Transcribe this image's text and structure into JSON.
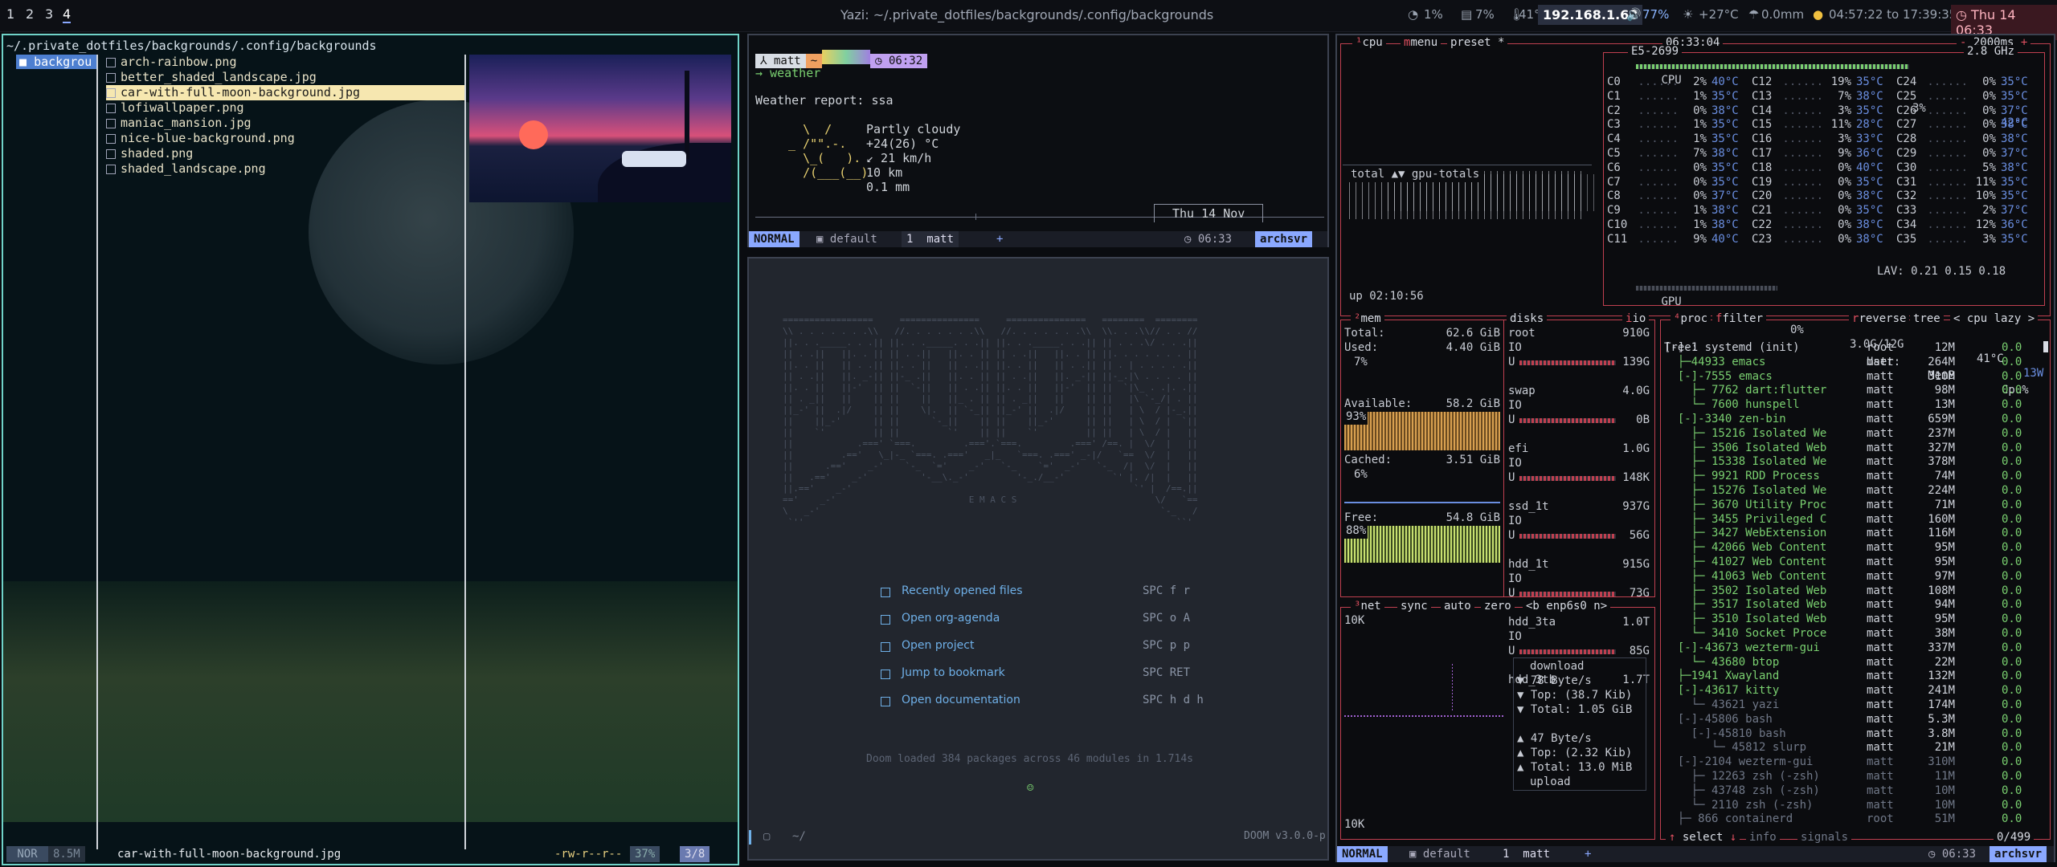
{
  "topbar": {
    "workspaces": [
      "1",
      "2",
      "3",
      "4"
    ],
    "active_workspace": "4",
    "window_title": "Yazi: ~/.private_dotfiles/backgrounds/.config/backgrounds",
    "cpu": "1%",
    "mem": "7%",
    "temp": "41°C",
    "ip": "192.168.1.68",
    "volume": "77%",
    "weather": "+27°C",
    "rain": "0.0mm",
    "sun": "04:57:22 to 17:39:35",
    "clock": "Thu 14 06:33"
  },
  "yazi": {
    "path": "~/.private_dotfiles/backgrounds/.config/backgrounds",
    "parent_item": "backgrou",
    "files": [
      "arch-rainbow.png",
      "better_shaded_landscape.jpg",
      "car-with-full-moon-background.jpg",
      "lofiwallpaper.png",
      "maniac_mansion.jpg",
      "nice-blue-background.png",
      "shaded.png",
      "shaded_landscape.png"
    ],
    "selected_index": 2,
    "status": {
      "mode": "NOR",
      "size": "8.5M",
      "filename": "car-with-full-moon-background.jpg",
      "perms": "-rw-r--r--",
      "percent": "37%",
      "position": "3/8"
    }
  },
  "weather_pane": {
    "user": "matt",
    "arrow": "~",
    "time": "06:32",
    "command": "weather",
    "report_line": "Weather report: ssa",
    "ascii": "   \\  /\n _ /\"\".-.\n   \\_(   ).\n   /(___(__)",
    "info": "Partly cloudy\n+24(26) °C\n↙ 21 km/h\n10 km\n0.1 mm",
    "date_box": "Thu 14 Nov",
    "tmux": {
      "mode": "NORMAL",
      "session": "default",
      "window_index": "1",
      "window_name": "matt",
      "plus": "+",
      "time": "06:33",
      "host": "archsvr"
    }
  },
  "emacs": {
    "banner": "E M A C S",
    "menu": [
      {
        "label": "Recently opened files",
        "key": "SPC f r"
      },
      {
        "label": "Open org-agenda",
        "key": "SPC o A"
      },
      {
        "label": "Open project",
        "key": "SPC p p"
      },
      {
        "label": "Jump to bookmark",
        "key": "SPC RET"
      },
      {
        "label": "Open documentation",
        "key": "SPC h d h"
      }
    ],
    "loaded": "Doom loaded 384 packages across 46 modules in 1.714s",
    "modeline_path": "~/",
    "modeline_right": "DOOM v3.0.0-p"
  },
  "btop": {
    "cpu_box": {
      "title_items": [
        "cpu",
        "menu",
        "preset *"
      ],
      "clock": "06:33:04",
      "interval": "2000ms",
      "model": "E5-2699",
      "freq": "2.8 GHz",
      "total_label": "CPU",
      "total_pct": "3%",
      "total_temp": "42°C",
      "graph_label": "total ▲▼ gpu-totals",
      "uptime": "up 02:10:56",
      "lav": "LAV: 0.21 0.15 0.18",
      "gpu_label": "GPU",
      "gpu_pct": "0%",
      "gpu_mem": "3.0G/12G",
      "gpu_temp": "41°C",
      "gpu_w": "13W",
      "cores": [
        [
          "C0",
          "2%",
          "40°C",
          "C12",
          "19%",
          "35°C",
          "C24",
          "0%",
          "35°C"
        ],
        [
          "C1",
          "1%",
          "35°C",
          "C13",
          "7%",
          "38°C",
          "C25",
          "0%",
          "35°C"
        ],
        [
          "C2",
          "0%",
          "38°C",
          "C14",
          "3%",
          "35°C",
          "C26",
          "0%",
          "37°C"
        ],
        [
          "C3",
          "1%",
          "35°C",
          "C15",
          "11%",
          "28°C",
          "C27",
          "0%",
          "38°C"
        ],
        [
          "C4",
          "1%",
          "35°C",
          "C16",
          "3%",
          "33°C",
          "C28",
          "0%",
          "38°C"
        ],
        [
          "C5",
          "7%",
          "38°C",
          "C17",
          "9%",
          "36°C",
          "C29",
          "0%",
          "37°C"
        ],
        [
          "C6",
          "0%",
          "35°C",
          "C18",
          "0%",
          "40°C",
          "C30",
          "5%",
          "38°C"
        ],
        [
          "C7",
          "0%",
          "35°C",
          "C19",
          "0%",
          "35°C",
          "C31",
          "11%",
          "35°C"
        ],
        [
          "C8",
          "0%",
          "37°C",
          "C20",
          "0%",
          "38°C",
          "C32",
          "10%",
          "35°C"
        ],
        [
          "C9",
          "1%",
          "38°C",
          "C21",
          "0%",
          "35°C",
          "C33",
          "2%",
          "37°C"
        ],
        [
          "C10",
          "1%",
          "38°C",
          "C22",
          "0%",
          "38°C",
          "C34",
          "12%",
          "36°C"
        ],
        [
          "C11",
          "9%",
          "40°C",
          "C23",
          "0%",
          "38°C",
          "C35",
          "3%",
          "35°C"
        ]
      ]
    },
    "mem_box": {
      "title": "mem",
      "total_label": "Total:",
      "total": "62.6 GiB",
      "used_label": "Used:",
      "used": "4.40 GiB",
      "used_pct": "7%",
      "avail_label": "Available:",
      "avail": "58.2 GiB",
      "avail_pct": "93%",
      "cached_label": "Cached:",
      "cached": "3.51 GiB",
      "cached_pct": "6%",
      "free_label": "Free:",
      "free": "54.8 GiB",
      "free_pct": "88%"
    },
    "disks_box": {
      "title": "disks",
      "io_label": "io",
      "disks": [
        {
          "name": "root",
          "size": "910G",
          "used": "139G"
        },
        {
          "name": "swap",
          "size": "4.0G",
          "used": "0B"
        },
        {
          "name": "efi",
          "size": "1.0G",
          "used": "148K"
        },
        {
          "name": "ssd_1t",
          "size": "937G",
          "used": "56G"
        },
        {
          "name": "hdd_1t",
          "size": "915G",
          "used": "73G"
        },
        {
          "name": "hdd_3ta",
          "size": "1.0T",
          "used": "85G"
        },
        {
          "name": "hdd_3tb",
          "size": "1.7T",
          "used": ""
        }
      ]
    },
    "net_box": {
      "title_items": [
        "net",
        "sync",
        "auto",
        "zero",
        "<b enp6s0 n>"
      ],
      "scale_top": "10K",
      "scale_bottom": "10K",
      "download_label": "download",
      "down_rate": "▼ 78 Byte/s",
      "down_top": "▼ Top: (38.7 Kib)",
      "down_total": "▼ Total: 1.05 GiB",
      "up_rate": "▲ 47 Byte/s",
      "up_top": "▲ Top: (2.32 Kib)",
      "up_total": "▲ Total: 13.0 MiB",
      "upload_label": "upload"
    },
    "proc_box": {
      "title_items": [
        "proc",
        "filter",
        "reverse",
        "tree",
        "< cpu lazy >"
      ],
      "header": {
        "tree": "Tree:",
        "user": "User:",
        "mem": "MemB",
        "cpu": "Cpu%"
      },
      "footer_select": "select",
      "footer_info": "info",
      "footer_signals": "signals",
      "footer_count": "0/499",
      "rows": [
        {
          "name": "[-]-1 systemd (init)",
          "user": "root",
          "mem": "12M",
          "cpu": "0.0"
        },
        {
          "name": "  ├─44933 emacs",
          "user": "matt",
          "mem": "264M",
          "cpu": "0.0"
        },
        {
          "name": "  [-]-7555 emacs",
          "user": "matt",
          "mem": "310M",
          "cpu": "0.0"
        },
        {
          "name": "    ├─ 7762 dart:flutter",
          "user": "matt",
          "mem": "98M",
          "cpu": "0.0"
        },
        {
          "name": "    └─ 7600 hunspell",
          "user": "matt",
          "mem": "13M",
          "cpu": "0.0"
        },
        {
          "name": "  [-]-3340 zen-bin",
          "user": "matt",
          "mem": "659M",
          "cpu": "0.0"
        },
        {
          "name": "    ├─ 15216 Isolated We",
          "user": "matt",
          "mem": "237M",
          "cpu": "0.0"
        },
        {
          "name": "    ├─ 3506 Isolated Web",
          "user": "matt",
          "mem": "327M",
          "cpu": "0.0"
        },
        {
          "name": "    ├─ 15338 Isolated We",
          "user": "matt",
          "mem": "378M",
          "cpu": "0.0"
        },
        {
          "name": "    ├─ 9921 RDD Process",
          "user": "matt",
          "mem": "74M",
          "cpu": "0.0"
        },
        {
          "name": "    ├─ 15276 Isolated We",
          "user": "matt",
          "mem": "224M",
          "cpu": "0.0"
        },
        {
          "name": "    ├─ 3670 Utility Proc",
          "user": "matt",
          "mem": "71M",
          "cpu": "0.0"
        },
        {
          "name": "    ├─ 3455 Privileged C",
          "user": "matt",
          "mem": "160M",
          "cpu": "0.0"
        },
        {
          "name": "    ├─ 3427 WebExtension",
          "user": "matt",
          "mem": "116M",
          "cpu": "0.0"
        },
        {
          "name": "    ├─ 42066 Web Content",
          "user": "matt",
          "mem": "95M",
          "cpu": "0.0"
        },
        {
          "name": "    ├─ 41027 Web Content",
          "user": "matt",
          "mem": "95M",
          "cpu": "0.0"
        },
        {
          "name": "    ├─ 41063 Web Content",
          "user": "matt",
          "mem": "97M",
          "cpu": "0.0"
        },
        {
          "name": "    ├─ 3502 Isolated Web",
          "user": "matt",
          "mem": "108M",
          "cpu": "0.0"
        },
        {
          "name": "    ├─ 3517 Isolated Web",
          "user": "matt",
          "mem": "94M",
          "cpu": "0.0"
        },
        {
          "name": "    ├─ 3510 Isolated Web",
          "user": "matt",
          "mem": "95M",
          "cpu": "0.0"
        },
        {
          "name": "    └─ 3410 Socket Proce",
          "user": "matt",
          "mem": "38M",
          "cpu": "0.0"
        },
        {
          "name": "  [-]-43673 wezterm-gui",
          "user": "matt",
          "mem": "337M",
          "cpu": "0.0"
        },
        {
          "name": "    └─ 43680 btop",
          "user": "matt",
          "mem": "22M",
          "cpu": "0.0"
        },
        {
          "name": "  ├─1941 Xwayland",
          "user": "matt",
          "mem": "132M",
          "cpu": "0.0"
        },
        {
          "name": "  [-]-43617 kitty",
          "user": "matt",
          "mem": "241M",
          "cpu": "0.0"
        },
        {
          "name": "    └─ 43621 yazi",
          "user": "matt",
          "mem": "174M",
          "cpu": "0.0"
        },
        {
          "name": "  [-]-45806 bash",
          "user": "matt",
          "mem": "5.3M",
          "cpu": "0.0"
        },
        {
          "name": "    [-]-45810 bash",
          "user": "matt",
          "mem": "3.8M",
          "cpu": "0.0"
        },
        {
          "name": "       └─ 45812 slurp",
          "user": "matt",
          "mem": "21M",
          "cpu": "0.0"
        },
        {
          "name": "  [-]-2104 wezterm-gui",
          "user": "matt",
          "mem": "310M",
          "cpu": "0.0"
        },
        {
          "name": "    ├─ 12263 zsh (-zsh)",
          "user": "matt",
          "mem": "11M",
          "cpu": "0.0"
        },
        {
          "name": "    ├─ 43748 zsh (-zsh)",
          "user": "matt",
          "mem": "10M",
          "cpu": "0.0"
        },
        {
          "name": "    └─ 2110 zsh (-zsh)",
          "user": "matt",
          "mem": "10M",
          "cpu": "0.0"
        },
        {
          "name": "  ├─ 866 containerd",
          "user": "root",
          "mem": "51M",
          "cpu": "0.0"
        }
      ]
    },
    "tmux": {
      "mode": "NORMAL",
      "session": "default",
      "window_index": "1",
      "window_name": "matt",
      "plus": "+",
      "time": "06:33",
      "host": "archsvr"
    }
  },
  "colors": {
    "yazi_border": "#6fd2c8",
    "btop_accent": "#c04050",
    "select_bg": "#f6e7b0",
    "tmux_mode": "#8aa8ff"
  }
}
